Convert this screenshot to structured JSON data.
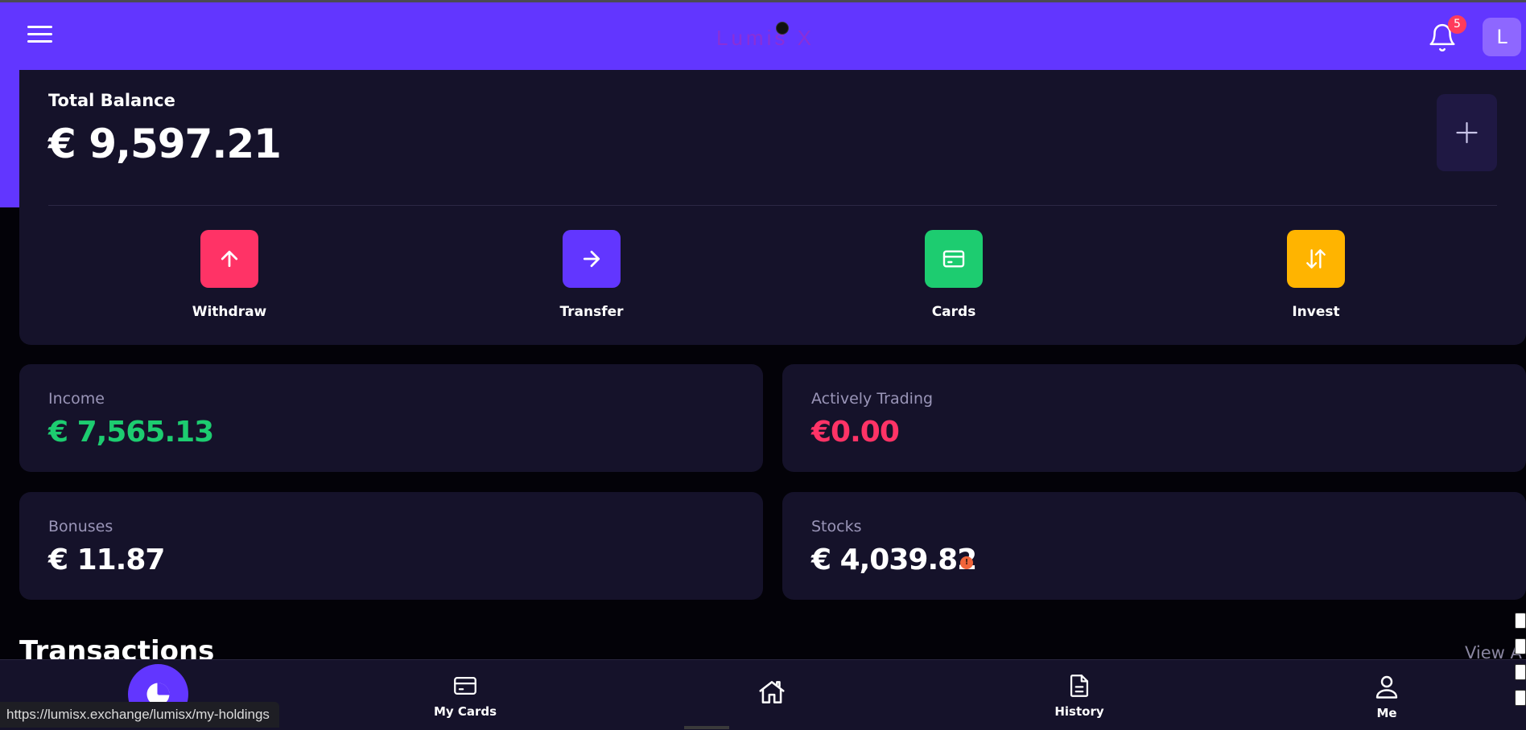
{
  "header": {
    "logo": "Lumis X",
    "notifications_count": "5",
    "avatar_initial": "L"
  },
  "balance": {
    "title": "Total Balance",
    "amount": "€ 9,597.21"
  },
  "actions": [
    {
      "label": "Withdraw",
      "icon": "arrow-up-icon",
      "color": "#ff3366"
    },
    {
      "label": "Transfer",
      "icon": "arrow-right-icon",
      "color": "#6236ff"
    },
    {
      "label": "Cards",
      "icon": "card-icon",
      "color": "#1dcc70"
    },
    {
      "label": "Invest",
      "icon": "arrows-up-down-icon",
      "color": "#ffb400"
    }
  ],
  "stats": {
    "income": {
      "title": "Income",
      "value": "€ 7,565.13",
      "color": "#1dcc70"
    },
    "trading": {
      "title": "Actively Trading",
      "value": "€0.00",
      "color": "#ff3366"
    },
    "bonuses": {
      "title": "Bonuses",
      "value": "€ 11.87",
      "color": "#ffffff"
    },
    "stocks": {
      "title": "Stocks",
      "value": "€ 4,039.82",
      "color": "#ffffff"
    }
  },
  "transactions": {
    "title": "Transactions",
    "view_all": "View A"
  },
  "bottom_nav": {
    "cards": "My Cards",
    "history": "History",
    "me": "Me"
  },
  "status_url": "https://lumisx.exchange/lumisx/my-holdings"
}
